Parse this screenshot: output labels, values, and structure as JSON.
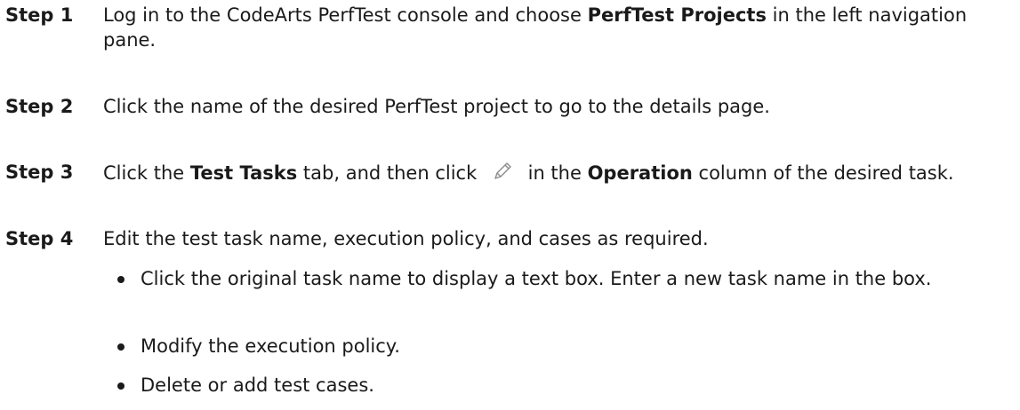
{
  "steps": [
    {
      "label": "Step 1",
      "pre": "Log in to the CodeArts PerfTest console and choose ",
      "bold": "PerfTest Projects",
      "post": " in the left navigation pane."
    },
    {
      "label": "Step 2",
      "text": "Click the name of the desired PerfTest project to go to the details page."
    },
    {
      "label": "Step 3",
      "pre": "Click the ",
      "bold1": "Test Tasks",
      "mid": " tab, and then click ",
      "icon": "pencil-edit-icon",
      "mid2": " in the ",
      "bold2": "Operation",
      "post": " column of the desired task."
    },
    {
      "label": "Step 4",
      "text": "Edit the test task name, execution policy, and cases as required."
    }
  ],
  "bullets": [
    "Click the original task name to display a text box. Enter a new task name in the box.",
    "Modify the execution policy.",
    "Delete or add test cases."
  ],
  "colors": {
    "text": "#1a1a1a",
    "icon": "#8a8a8a"
  }
}
